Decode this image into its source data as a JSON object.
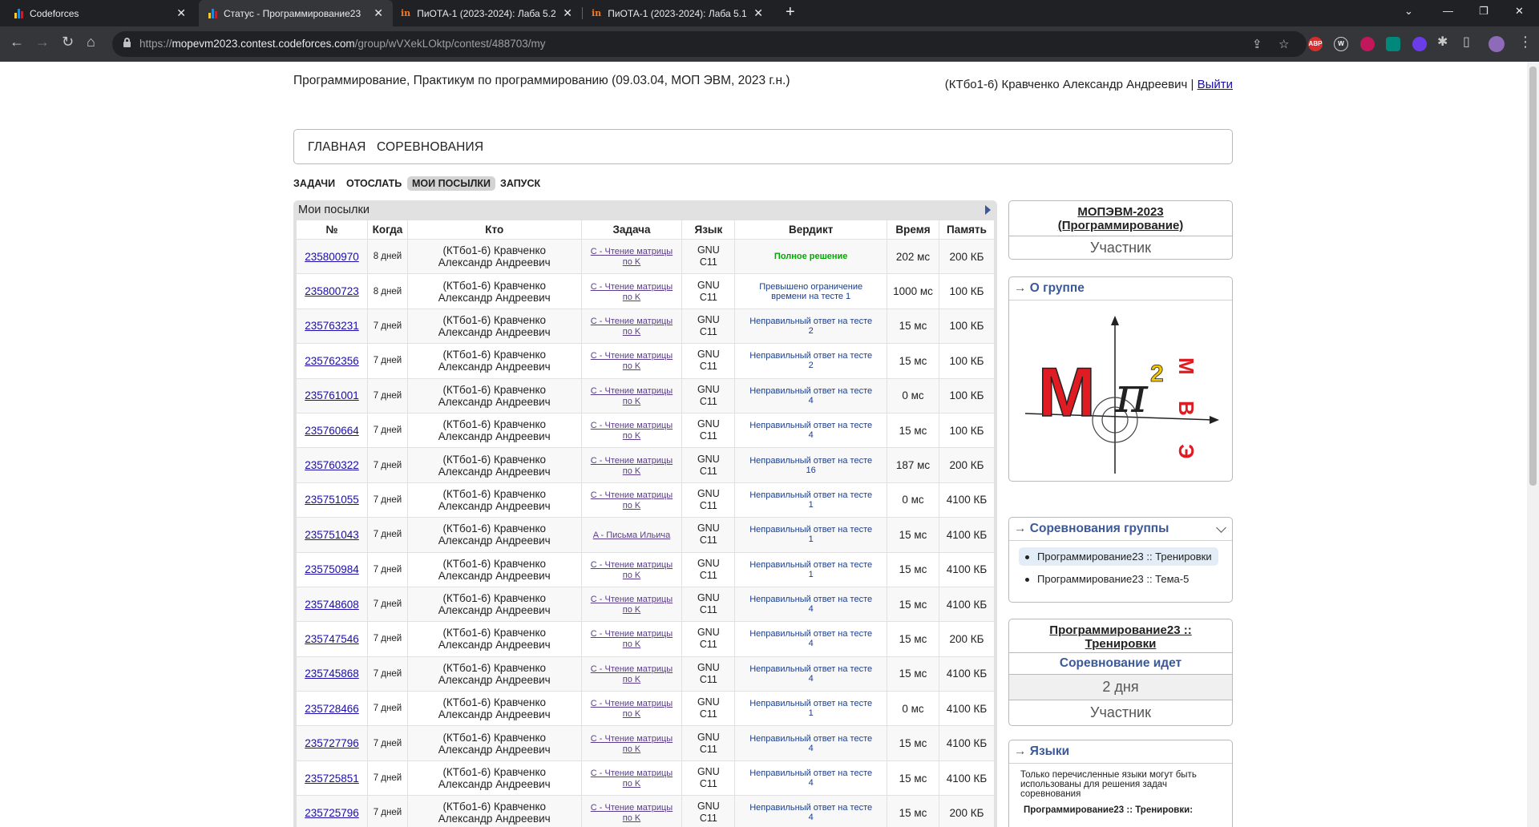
{
  "browser": {
    "tabs": [
      {
        "title": "Codeforces",
        "active": false
      },
      {
        "title": "Статус - Программирование23",
        "active": true
      },
      {
        "title": "ПиОТА-1 (2023-2024): Лаба 5.2",
        "active": false
      },
      {
        "title": "ПиОТА-1 (2023-2024): Лаба 5.1",
        "active": false
      }
    ],
    "new_tab": "+",
    "url_prefix": "https://",
    "url_host": "mopevm2023.contest.codeforces.com",
    "url_path": "/group/wVXekLOktp/contest/488703/my",
    "extensions": [
      "ABP",
      "W"
    ],
    "colors": {
      "tabbar": "#202124",
      "toolbar": "#35363a",
      "link": "#1a0dab",
      "accent": "#3b5998",
      "ok": "#00aa00"
    }
  },
  "header": {
    "site_title": "Программирование, Практикум по программированию (09.03.04, МОП ЭВМ, 2023 г.н.)",
    "user": "(КТбо1-6) Кравченко Александр Андреевич",
    "separator": "|",
    "logout": "Выйти"
  },
  "main_menu": {
    "home": "ГЛАВНАЯ",
    "contests": "СОРЕВНОВАНИЯ"
  },
  "second_menu": {
    "problems": "ЗАДАЧИ",
    "submit": "ОТОСЛАТЬ",
    "my": "МОИ ПОСЫЛКИ",
    "custom": "ЗАПУСК"
  },
  "submissions": {
    "caption": "Мои посылки",
    "headers": [
      "№",
      "Когда",
      "Кто",
      "Задача",
      "Язык",
      "Вердикт",
      "Время",
      "Память"
    ],
    "rows": [
      {
        "id": "235800970",
        "when": "8 дней",
        "who1": "(КТбо1-6) Кравченко",
        "who2": "Александр Андреевич",
        "prob1": "C - Чтение матрицы",
        "prob2": "по K",
        "lang1": "GNU",
        "lang2": "C11",
        "v1": "Полное решение",
        "v2": "",
        "ok": true,
        "time": "202 мс",
        "mem": "200 КБ"
      },
      {
        "id": "235800723",
        "when": "8 дней",
        "who1": "(КТбо1-6) Кравченко",
        "who2": "Александр Андреевич",
        "prob1": "C - Чтение матрицы",
        "prob2": "по K",
        "lang1": "GNU",
        "lang2": "C11",
        "v1": "Превышено ограничение",
        "v2": "времени на тесте 1",
        "ok": false,
        "time": "1000 мс",
        "mem": "100 КБ"
      },
      {
        "id": "235763231",
        "when": "7 дней",
        "who1": "(КТбо1-6) Кравченко",
        "who2": "Александр Андреевич",
        "prob1": "C - Чтение матрицы",
        "prob2": "по K",
        "lang1": "GNU",
        "lang2": "C11",
        "v1": "Неправильный ответ на тесте",
        "v2": "2",
        "ok": false,
        "time": "15 мс",
        "mem": "100 КБ"
      },
      {
        "id": "235762356",
        "when": "7 дней",
        "who1": "(КТбо1-6) Кравченко",
        "who2": "Александр Андреевич",
        "prob1": "C - Чтение матрицы",
        "prob2": "по K",
        "lang1": "GNU",
        "lang2": "C11",
        "v1": "Неправильный ответ на тесте",
        "v2": "2",
        "ok": false,
        "time": "15 мс",
        "mem": "100 КБ"
      },
      {
        "id": "235761001",
        "when": "7 дней",
        "who1": "(КТбо1-6) Кравченко",
        "who2": "Александр Андреевич",
        "prob1": "C - Чтение матрицы",
        "prob2": "по K",
        "lang1": "GNU",
        "lang2": "C11",
        "v1": "Неправильный ответ на тесте",
        "v2": "4",
        "ok": false,
        "time": "0 мс",
        "mem": "100 КБ"
      },
      {
        "id": "235760664",
        "when": "7 дней",
        "who1": "(КТбо1-6) Кравченко",
        "who2": "Александр Андреевич",
        "prob1": "C - Чтение матрицы",
        "prob2": "по K",
        "lang1": "GNU",
        "lang2": "C11",
        "v1": "Неправильный ответ на тесте",
        "v2": "4",
        "ok": false,
        "time": "15 мс",
        "mem": "100 КБ"
      },
      {
        "id": "235760322",
        "when": "7 дней",
        "who1": "(КТбо1-6) Кравченко",
        "who2": "Александр Андреевич",
        "prob1": "C - Чтение матрицы",
        "prob2": "по K",
        "lang1": "GNU",
        "lang2": "C11",
        "v1": "Неправильный ответ на тесте",
        "v2": "16",
        "ok": false,
        "time": "187 мс",
        "mem": "200 КБ"
      },
      {
        "id": "235751055",
        "when": "7 дней",
        "who1": "(КТбо1-6) Кравченко",
        "who2": "Александр Андреевич",
        "prob1": "C - Чтение матрицы",
        "prob2": "по K",
        "lang1": "GNU",
        "lang2": "C11",
        "v1": "Неправильный ответ на тесте",
        "v2": "1",
        "ok": false,
        "time": "0 мс",
        "mem": "4100 КБ"
      },
      {
        "id": "235751043",
        "when": "7 дней",
        "who1": "(КТбо1-6) Кравченко",
        "who2": "Александр Андреевич",
        "prob1": "A - Письма Ильича",
        "prob2": "",
        "lang1": "GNU",
        "lang2": "C11",
        "v1": "Неправильный ответ на тесте",
        "v2": "1",
        "ok": false,
        "time": "15 мс",
        "mem": "4100 КБ"
      },
      {
        "id": "235750984",
        "when": "7 дней",
        "who1": "(КТбо1-6) Кравченко",
        "who2": "Александр Андреевич",
        "prob1": "C - Чтение матрицы",
        "prob2": "по K",
        "lang1": "GNU",
        "lang2": "C11",
        "v1": "Неправильный ответ на тесте",
        "v2": "1",
        "ok": false,
        "time": "15 мс",
        "mem": "4100 КБ"
      },
      {
        "id": "235748608",
        "when": "7 дней",
        "who1": "(КТбо1-6) Кравченко",
        "who2": "Александр Андреевич",
        "prob1": "C - Чтение матрицы",
        "prob2": "по K",
        "lang1": "GNU",
        "lang2": "C11",
        "v1": "Неправильный ответ на тесте",
        "v2": "4",
        "ok": false,
        "time": "15 мс",
        "mem": "4100 КБ"
      },
      {
        "id": "235747546",
        "when": "7 дней",
        "who1": "(КТбо1-6) Кравченко",
        "who2": "Александр Андреевич",
        "prob1": "C - Чтение матрицы",
        "prob2": "по K",
        "lang1": "GNU",
        "lang2": "C11",
        "v1": "Неправильный ответ на тесте",
        "v2": "4",
        "ok": false,
        "time": "15 мс",
        "mem": "200 КБ"
      },
      {
        "id": "235745868",
        "when": "7 дней",
        "who1": "(КТбо1-6) Кравченко",
        "who2": "Александр Андреевич",
        "prob1": "C - Чтение матрицы",
        "prob2": "по K",
        "lang1": "GNU",
        "lang2": "C11",
        "v1": "Неправильный ответ на тесте",
        "v2": "4",
        "ok": false,
        "time": "15 мс",
        "mem": "4100 КБ"
      },
      {
        "id": "235728466",
        "when": "7 дней",
        "who1": "(КТбо1-6) Кравченко",
        "who2": "Александр Андреевич",
        "prob1": "C - Чтение матрицы",
        "prob2": "по K",
        "lang1": "GNU",
        "lang2": "C11",
        "v1": "Неправильный ответ на тесте",
        "v2": "1",
        "ok": false,
        "time": "0 мс",
        "mem": "4100 КБ"
      },
      {
        "id": "235727796",
        "when": "7 дней",
        "who1": "(КТбо1-6) Кравченко",
        "who2": "Александр Андреевич",
        "prob1": "C - Чтение матрицы",
        "prob2": "по K",
        "lang1": "GNU",
        "lang2": "C11",
        "v1": "Неправильный ответ на тесте",
        "v2": "4",
        "ok": false,
        "time": "15 мс",
        "mem": "4100 КБ"
      },
      {
        "id": "235725851",
        "when": "7 дней",
        "who1": "(КТбо1-6) Кравченко",
        "who2": "Александр Андреевич",
        "prob1": "C - Чтение матрицы",
        "prob2": "по K",
        "lang1": "GNU",
        "lang2": "C11",
        "v1": "Неправильный ответ на тесте",
        "v2": "4",
        "ok": false,
        "time": "15 мс",
        "mem": "4100 КБ"
      },
      {
        "id": "235725796",
        "when": "7 дней",
        "who1": "(КТбо1-6) Кравченко",
        "who2": "Александр Андреевич",
        "prob1": "C - Чтение матрицы",
        "prob2": "по K",
        "lang1": "GNU",
        "lang2": "C11",
        "v1": "Неправильный ответ на тесте",
        "v2": "4",
        "ok": false,
        "time": "15 мс",
        "mem": "200 КБ"
      }
    ]
  },
  "sidebar": {
    "group_title_1": "МОПЭВМ-2023",
    "group_title_2": "(Программирование)",
    "group_role": "Участник",
    "about_caption": "→ О группе",
    "logo_letters": {
      "m": "М",
      "pi": "π",
      "sq": "2",
      "e": "Э",
      "v": "В",
      "m2": "М"
    },
    "contests_caption": "→ Соревнования группы",
    "contests": [
      "Программирование23 :: Тренировки",
      "Программирование23 :: Тема-5"
    ],
    "current_contest_1": "Программирование23 ::",
    "current_contest_2": "Тренировки",
    "contest_state": "Соревнование идет",
    "contest_time": "2 дня",
    "contest_role": "Участник",
    "languages_caption": "→ Языки",
    "languages_note": "Только перечисленные языки могут быть использованы для решения задач соревнования",
    "languages_contest": "Программирование23 :: Тренировки:"
  }
}
